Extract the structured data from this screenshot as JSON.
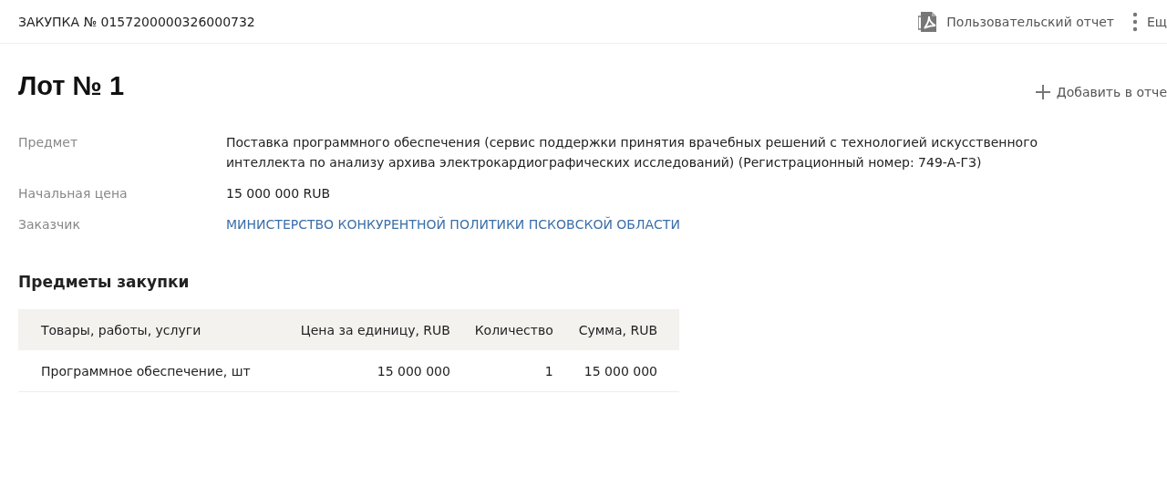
{
  "header": {
    "title": "ЗАКУПКА № 0157200000326000732",
    "report_link": "Пользовательский отчет",
    "more": "Ещ"
  },
  "lot": {
    "title": "Лот № 1",
    "add_to_report": "Добавить в отче",
    "fields": [
      {
        "label": "Предмет",
        "value": "Поставка программного обеспечения (сервис поддержки принятия врачебных решений с технологией искусственного интеллекта по анализу архива электрокардиографических исследований) (Регистрационный номер: 749-А-ГЗ)",
        "kind": "text"
      },
      {
        "label": "Начальная цена",
        "value": "15 000 000 RUB",
        "kind": "text"
      },
      {
        "label": "Заказчик",
        "value": "МИНИСТЕРСТВО КОНКУРЕНТНОЙ ПОЛИТИКИ ПСКОВСКОЙ ОБЛАСТИ",
        "kind": "link"
      }
    ]
  },
  "items": {
    "title": "Предметы закупки",
    "table": {
      "columns": [
        "Товары, работы, услуги",
        "Цена за единицу, RUB",
        "Количество",
        "Сумма, RUB"
      ],
      "rows": [
        [
          "Программное обеспечение, шт",
          "15 000 000",
          "1",
          "15 000 000"
        ]
      ]
    }
  }
}
